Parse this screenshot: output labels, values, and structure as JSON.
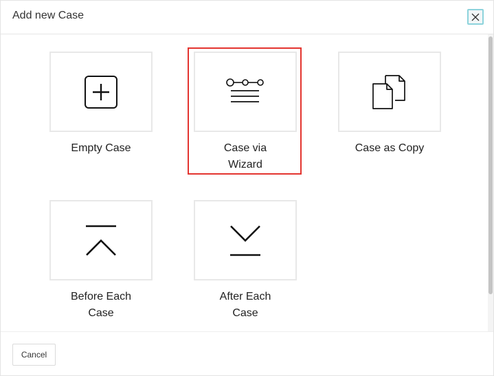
{
  "dialog": {
    "title": "Add new Case",
    "close_icon": "close-icon"
  },
  "options": [
    {
      "label_line1": "Empty Case",
      "label_line2": "",
      "icon": "plus-square-icon",
      "selected": false
    },
    {
      "label_line1": "Case via",
      "label_line2": "Wizard",
      "icon": "wizard-steps-icon",
      "selected": true
    },
    {
      "label_line1": "Case as Copy",
      "label_line2": "",
      "icon": "copy-documents-icon",
      "selected": false
    },
    {
      "label_line1": "Before Each",
      "label_line2": "Case",
      "icon": "before-each-icon",
      "selected": false
    },
    {
      "label_line1": "After Each",
      "label_line2": "Case",
      "icon": "after-each-icon",
      "selected": false
    }
  ],
  "footer": {
    "cancel_label": "Cancel"
  },
  "colors": {
    "selected_border": "#e3342f",
    "close_border": "#8dd3dc"
  }
}
